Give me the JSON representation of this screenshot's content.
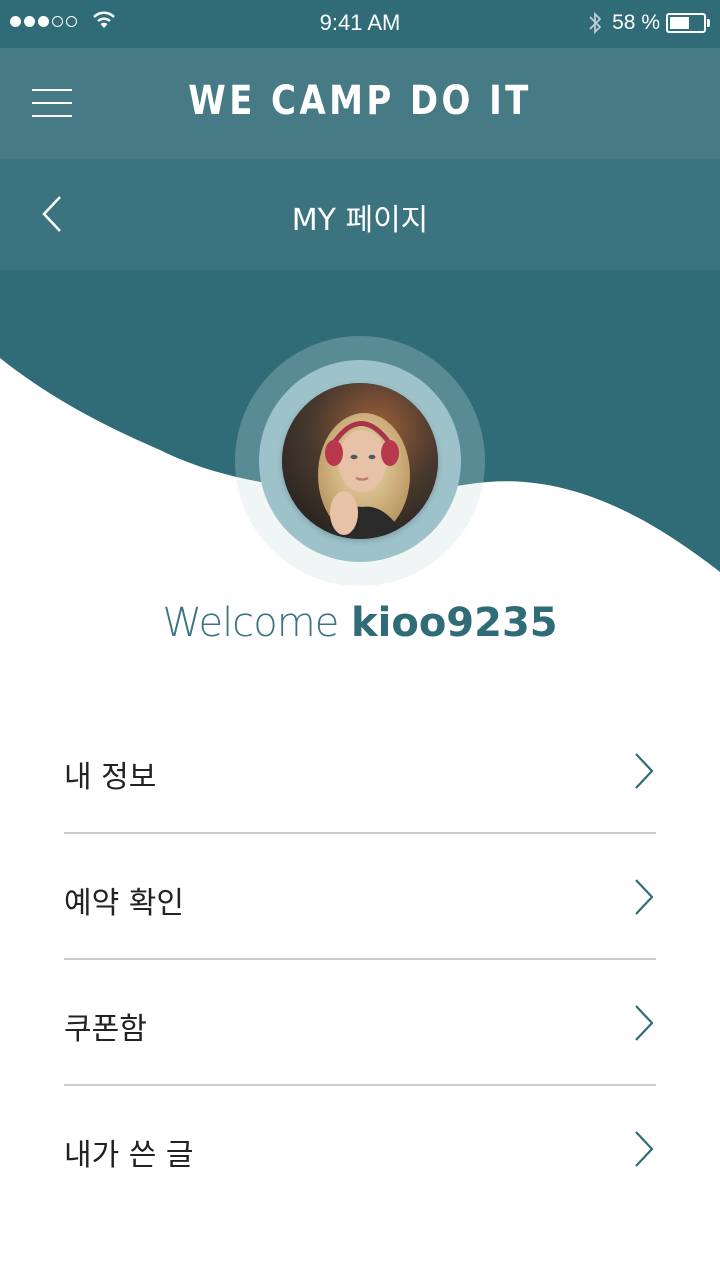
{
  "status_bar": {
    "time": "9:41 AM",
    "battery_percent": "58 %",
    "battery_level": 0.58,
    "signal_bars_filled": 3,
    "signal_bars_total": 5,
    "icons": [
      "signal-icon",
      "wifi-icon",
      "bluetooth-icon",
      "battery-icon"
    ]
  },
  "header": {
    "title": "WE CAMP DO IT",
    "menu_icon": "hamburger-icon"
  },
  "sub_header": {
    "title": "MY 페이지",
    "back_icon": "chevron-left-icon"
  },
  "profile": {
    "welcome_label": "Welcome",
    "username": "kioo9235"
  },
  "menu": {
    "items": [
      {
        "label": "내 정보",
        "icon": "chevron-right-icon"
      },
      {
        "label": "예약 확인",
        "icon": "chevron-right-icon"
      },
      {
        "label": "쿠폰함",
        "icon": "chevron-right-icon"
      },
      {
        "label": "내가 쓴 글",
        "icon": "chevron-right-icon"
      }
    ]
  },
  "colors": {
    "primary": "#2f6c78",
    "header_bg": "#467b85",
    "sub_header_bg": "#3b737e",
    "divider": "#cccccc"
  }
}
